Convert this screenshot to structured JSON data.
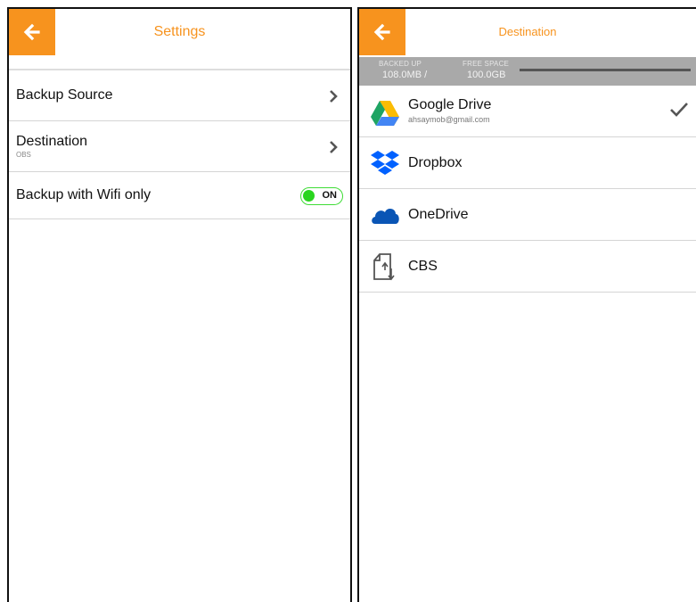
{
  "settings_screen": {
    "title": "Settings",
    "rows": [
      {
        "label": "Backup Source",
        "sub": ""
      },
      {
        "label": "Destination",
        "sub": "OBS"
      },
      {
        "label": "Backup with Wifi only",
        "toggle": "ON",
        "toggle_on": true
      }
    ]
  },
  "destination_screen": {
    "title": "Destination",
    "storage": {
      "backed_up_caption": "BACKED UP",
      "backed_up_value": "108.0MB /",
      "free_space_caption": "FREE SPACE",
      "free_space_value": "100.0GB"
    },
    "destinations": [
      {
        "label": "Google Drive",
        "sub": "ahsaymob@gmail.com",
        "icon": "google-drive-icon",
        "selected": true
      },
      {
        "label": "Dropbox",
        "icon": "dropbox-icon"
      },
      {
        "label": "OneDrive",
        "icon": "onedrive-icon"
      },
      {
        "label": "CBS",
        "icon": "cbs-file-icon"
      }
    ]
  },
  "colors": {
    "accent": "#f7931e",
    "toggle_green": "#2ad51f",
    "storage_bar": "#a9a9a9"
  }
}
